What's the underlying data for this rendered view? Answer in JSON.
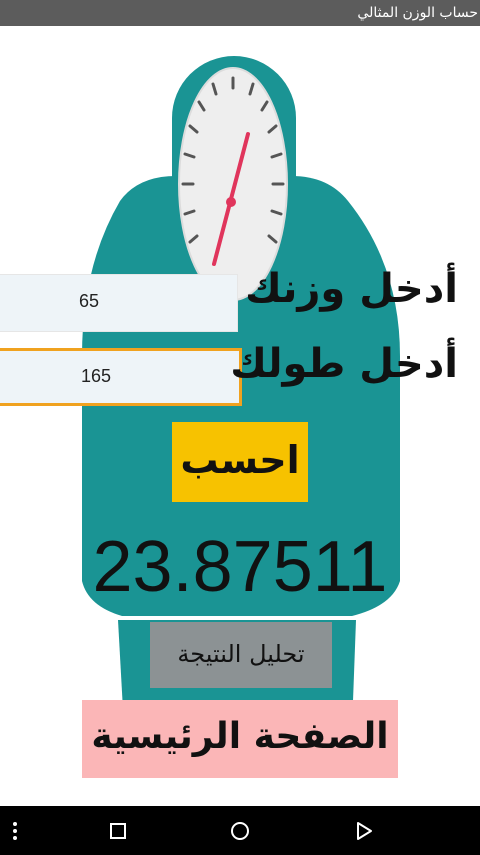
{
  "window": {
    "title": "حساب الوزن المثالي"
  },
  "form": {
    "weight_label": "أدخل وزنك",
    "weight_value": "65",
    "height_label": "أدخل طولك",
    "height_value": "165",
    "calculate_label": "احسب"
  },
  "result": {
    "value": "23.87511"
  },
  "actions": {
    "analyze_label": "تحليل النتيجة",
    "home_label": "الصفحة الرئيسية"
  },
  "colors": {
    "scale_teal": "#1a9494",
    "accent_orange": "#f0a21f",
    "calc_yellow": "#f7c200",
    "home_pink": "#fbb6b7",
    "analyze_gray": "#8c9294"
  },
  "navbar": {
    "icons": [
      "more-vertical-icon",
      "square-icon",
      "circle-icon",
      "triangle-back-icon"
    ]
  }
}
